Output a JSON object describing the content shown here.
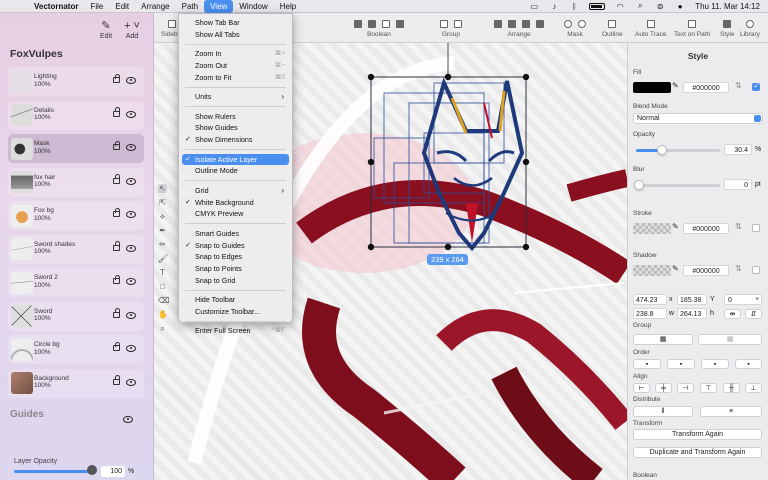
{
  "menubar": {
    "app": "Vectornator",
    "menus": [
      "File",
      "Edit",
      "Arrange",
      "Path",
      "View",
      "Window",
      "Help"
    ],
    "active": "View",
    "clock": "Thu 11. Mar 14:12"
  },
  "sidebar": {
    "tools": [
      {
        "label": "Edit",
        "icon": "pencil-icon"
      },
      {
        "label": "Add",
        "icon": "plus-icon"
      }
    ],
    "document_title": "FoxVulpes",
    "layers": [
      {
        "name": "Lighting",
        "opacity": "100%",
        "locked": false,
        "selected": false
      },
      {
        "name": "Details",
        "opacity": "100%",
        "locked": false,
        "selected": false
      },
      {
        "name": "Mask",
        "opacity": "100%",
        "locked": false,
        "selected": true
      },
      {
        "name": "fox hair",
        "opacity": "100%",
        "locked": false,
        "selected": false
      },
      {
        "name": "Fox bg",
        "opacity": "100%",
        "locked": false,
        "selected": false
      },
      {
        "name": "Sword shades",
        "opacity": "100%",
        "locked": false,
        "selected": false
      },
      {
        "name": "Sword 2",
        "opacity": "100%",
        "locked": false,
        "selected": false
      },
      {
        "name": "Sword",
        "opacity": "100%",
        "locked": false,
        "selected": false
      },
      {
        "name": "Circle bg",
        "opacity": "100%",
        "locked": true,
        "selected": false
      },
      {
        "name": "Background",
        "opacity": "100%",
        "locked": true,
        "selected": false
      }
    ],
    "guides_title": "Guides",
    "layer_opacity_label": "Layer Opacity",
    "layer_opacity_value": "100",
    "layer_opacity_unit": "%"
  },
  "toolbar": {
    "sidebar_label": "Sidebar",
    "groups": [
      "Boolean",
      "Group",
      "Arrange",
      "Mask",
      "Outline",
      "Auto Trace",
      "Text on Path",
      "Style",
      "Library"
    ]
  },
  "view_menu": {
    "items": [
      {
        "label": "Show Tab Bar",
        "type": "item"
      },
      {
        "label": "Show All Tabs",
        "type": "item"
      },
      {
        "type": "sep"
      },
      {
        "label": "Zoom In",
        "type": "item",
        "shortcut": "⌘+"
      },
      {
        "label": "Zoom Out",
        "type": "item",
        "shortcut": "⌘−"
      },
      {
        "label": "Zoom to Fit",
        "type": "item",
        "shortcut": "⌘0"
      },
      {
        "type": "sep"
      },
      {
        "label": "Units",
        "type": "submenu"
      },
      {
        "type": "sep"
      },
      {
        "label": "Show Rulers",
        "type": "item"
      },
      {
        "label": "Show Guides",
        "type": "item"
      },
      {
        "label": "Show Dimensions",
        "type": "item",
        "checked": true
      },
      {
        "type": "sep"
      },
      {
        "label": "Isolate Active Layer",
        "type": "item",
        "checked": true,
        "highlighted": true
      },
      {
        "label": "Outline Mode",
        "type": "item"
      },
      {
        "type": "sep"
      },
      {
        "label": "Grid",
        "type": "submenu"
      },
      {
        "label": "White Background",
        "type": "item",
        "checked": true
      },
      {
        "label": "CMYK Preview",
        "type": "item"
      },
      {
        "type": "sep"
      },
      {
        "label": "Smart Guides",
        "type": "item"
      },
      {
        "label": "Snap to Guides",
        "type": "item",
        "checked": true
      },
      {
        "label": "Snap to Edges",
        "type": "item"
      },
      {
        "label": "Snap to Points",
        "type": "item"
      },
      {
        "label": "Snap to Grid",
        "type": "item"
      },
      {
        "type": "sep"
      },
      {
        "label": "Hide Toolbar",
        "type": "item"
      },
      {
        "label": "Customize Toolbar...",
        "type": "item"
      },
      {
        "type": "sep"
      },
      {
        "label": "Enter Full Screen",
        "type": "item",
        "shortcut": "^⌘F"
      }
    ]
  },
  "canvas": {
    "dimension_label": "239 x 264"
  },
  "style_panel": {
    "title": "Style",
    "fill_label": "Fill",
    "fill_hex": "#000000",
    "blend_label": "Blend Mode",
    "blend_value": "Normal",
    "opacity_label": "Opacity",
    "opacity_value": "30.4",
    "opacity_unit": "%",
    "blur_label": "Blur",
    "blur_value": "0",
    "blur_unit": "pt",
    "stroke_label": "Stroke",
    "stroke_hex": "#000000",
    "shadow_label": "Shadow",
    "shadow_hex": "#000000",
    "x": "474.23",
    "x_unit": "x",
    "y": "185.38",
    "y_unit": "Y",
    "rotation": "0",
    "w": "238.8",
    "w_unit": "w",
    "h": "264.13",
    "h_unit": "h",
    "group_label": "Group",
    "order_label": "Order",
    "align_label": "Align",
    "distribute_label": "Distribute",
    "transform_label": "Transform",
    "transform_again": "Transform Again",
    "duplicate_transform": "Duplicate and Transform Again",
    "boolean_label": "Boolean"
  },
  "colors": {
    "accent": "#4a8ef0",
    "sword_red": "#8a1020",
    "mask_blue": "#1e3a7a",
    "mask_yellow": "#e0a020"
  }
}
